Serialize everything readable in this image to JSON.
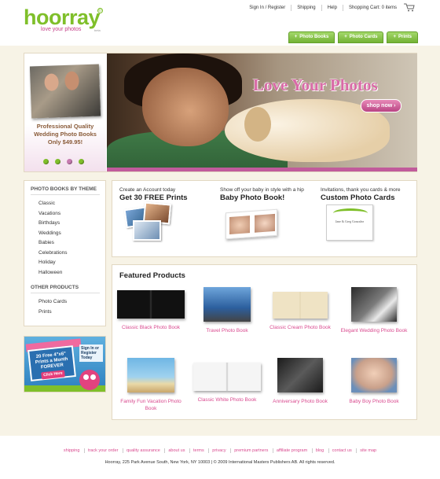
{
  "header": {
    "logo": "hoorray",
    "tagline": "love your photos",
    "logo_badge": "beta",
    "nav": [
      "Sign In / Register",
      "Shipping",
      "Help",
      "Shopping Cart: 0 items"
    ],
    "tabs": [
      "Photo Books",
      "Photo Cards",
      "Prints"
    ],
    "accent_green": "#7fbf2a",
    "accent_pink": "#d94a8f"
  },
  "hero": {
    "promo_lines": [
      "Professional Quality",
      "Wedding Photo Books",
      "Only $49.95!"
    ],
    "slides": 4,
    "active_slide": 3,
    "title": "Love Your Photos",
    "shop_button": "shop now ›"
  },
  "sidebar": {
    "books_heading": "PHOTO BOOKS BY THEME",
    "book_themes": [
      "Classic",
      "Vacations",
      "Birthdays",
      "Weddings",
      "Babies",
      "Celebrations",
      "Holiday",
      "Halloween"
    ],
    "other_heading": "OTHER PRODUCTS",
    "other_items": [
      "Photo Cards",
      "Prints"
    ]
  },
  "ad": {
    "sign_lines": [
      "20 Free 4\"x6\"",
      "Prints a Month",
      "FOREVER"
    ],
    "click": "Click Here",
    "signin": "Sign In or Register Today"
  },
  "promos": [
    {
      "small": "Create an Account today",
      "big": "Get 30 FREE Prints"
    },
    {
      "small": "Show off your baby in style with a hip",
      "big": "Baby Photo Book!"
    },
    {
      "small": "Invitations, thank you cards & more",
      "big": "Custom Photo Cards",
      "card_text": "Jane & Greg Gonzalez"
    }
  ],
  "featured": {
    "title": "Featured Products",
    "products": [
      {
        "name": "Classic Black Photo Book",
        "color": "#1e1e1e"
      },
      {
        "name": "Travel Photo Book",
        "color": "#3a6fb0"
      },
      {
        "name": "Classic Cream Photo Book",
        "color": "#efe3c4"
      },
      {
        "name": "Elegant Wedding Photo Book",
        "color": "#4a4a4a"
      },
      {
        "name": "Family Fun Vacation Photo Book",
        "color": "#5aa7d8"
      },
      {
        "name": "Classic White Photo Book",
        "color": "#f5f5f5"
      },
      {
        "name": "Anniversary Photo Book",
        "color": "#2a2a2a"
      },
      {
        "name": "Baby Boy Photo Book",
        "color": "#7aa6d6"
      }
    ]
  },
  "footer": {
    "links": [
      "shipping",
      "track your order",
      "quality assurance",
      "about us",
      "terms",
      "privacy",
      "premium partners",
      "affiliate program",
      "blog",
      "contact us",
      "site map"
    ],
    "copyright": "Hoorray, 225 Park Avenue South, New York, NY 10003 | © 2009 International Masters Publishers AB. All rights reserved."
  }
}
